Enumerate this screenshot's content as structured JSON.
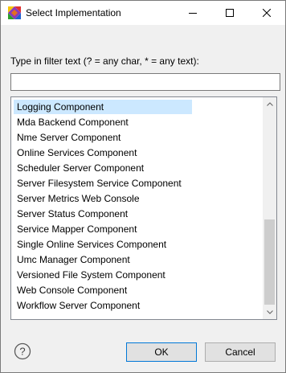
{
  "window": {
    "title": "Select Implementation"
  },
  "filter": {
    "label": "Type in filter text (? = any char, * = any text):",
    "value": "",
    "placeholder": ""
  },
  "list": {
    "selected_index": 0,
    "items": [
      "Logging Component",
      "Mda Backend Component",
      "Nme Server Component",
      "Online Services Component",
      "Scheduler Server Component",
      "Server Filesystem Service Component",
      "Server Metrics Web Console",
      "Server Status Component",
      "Service Mapper Component",
      "Single Online Services Component",
      "Umc Manager Component",
      "Versioned File System Component",
      "Web Console Component",
      "Workflow Server Component"
    ]
  },
  "buttons": {
    "ok_label": "OK",
    "cancel_label": "Cancel"
  },
  "icons": {
    "app": "app-logo-icon",
    "help": "help-icon"
  },
  "colors": {
    "selection": "#cce8ff",
    "default_button_border": "#0078d7"
  }
}
